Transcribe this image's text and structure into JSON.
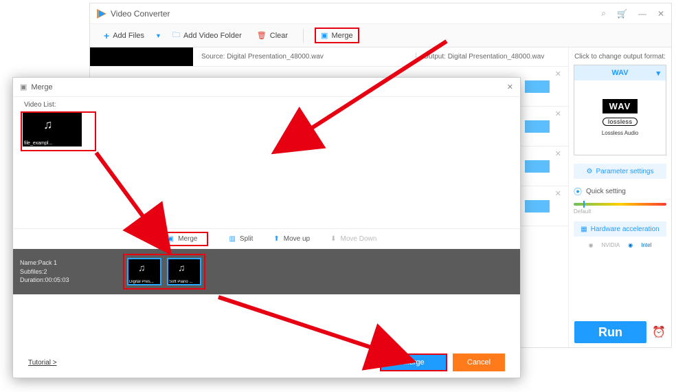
{
  "main": {
    "title": "Video Converter",
    "toolbar": {
      "add_files": "Add Files",
      "add_folder": "Add Video Folder",
      "clear": "Clear",
      "merge": "Merge"
    },
    "source_prefix": "Source: ",
    "output_prefix": "Output: ",
    "source_file": "Digital Presentation_48000.wav",
    "output_file": "Digital Presentation_48000.wav"
  },
  "right": {
    "header": "Click to change output format:",
    "format_code": "WAV",
    "format_badge": "WAV",
    "lossless_badge": "lossless",
    "lossless_caption": "Lossless Audio",
    "parameter": "Parameter settings",
    "quick": "Quick setting",
    "default_label": "Default",
    "hw": "Hardware acceleration",
    "vendor_nvidia": "NVIDIA",
    "vendor_intel": "Intel",
    "run": "Run"
  },
  "dialog": {
    "title": "Merge",
    "video_list_label": "Video List:",
    "thumb1_caption": "file_exampl...",
    "toolbar": {
      "merge": "Merge",
      "split": "Split",
      "moveup": "Move up",
      "movedown": "Move Down"
    },
    "pack": {
      "name_label": "Name:Pack 1",
      "subfiles_label": "Subfiles:2",
      "duration_label": "Duration:00:05:03",
      "thumb_a": "Digital Pres...",
      "thumb_b": "Soft Piano ..."
    },
    "tutorial": "Tutorial >",
    "merge_btn": "Merge",
    "cancel_btn": "Cancel"
  }
}
